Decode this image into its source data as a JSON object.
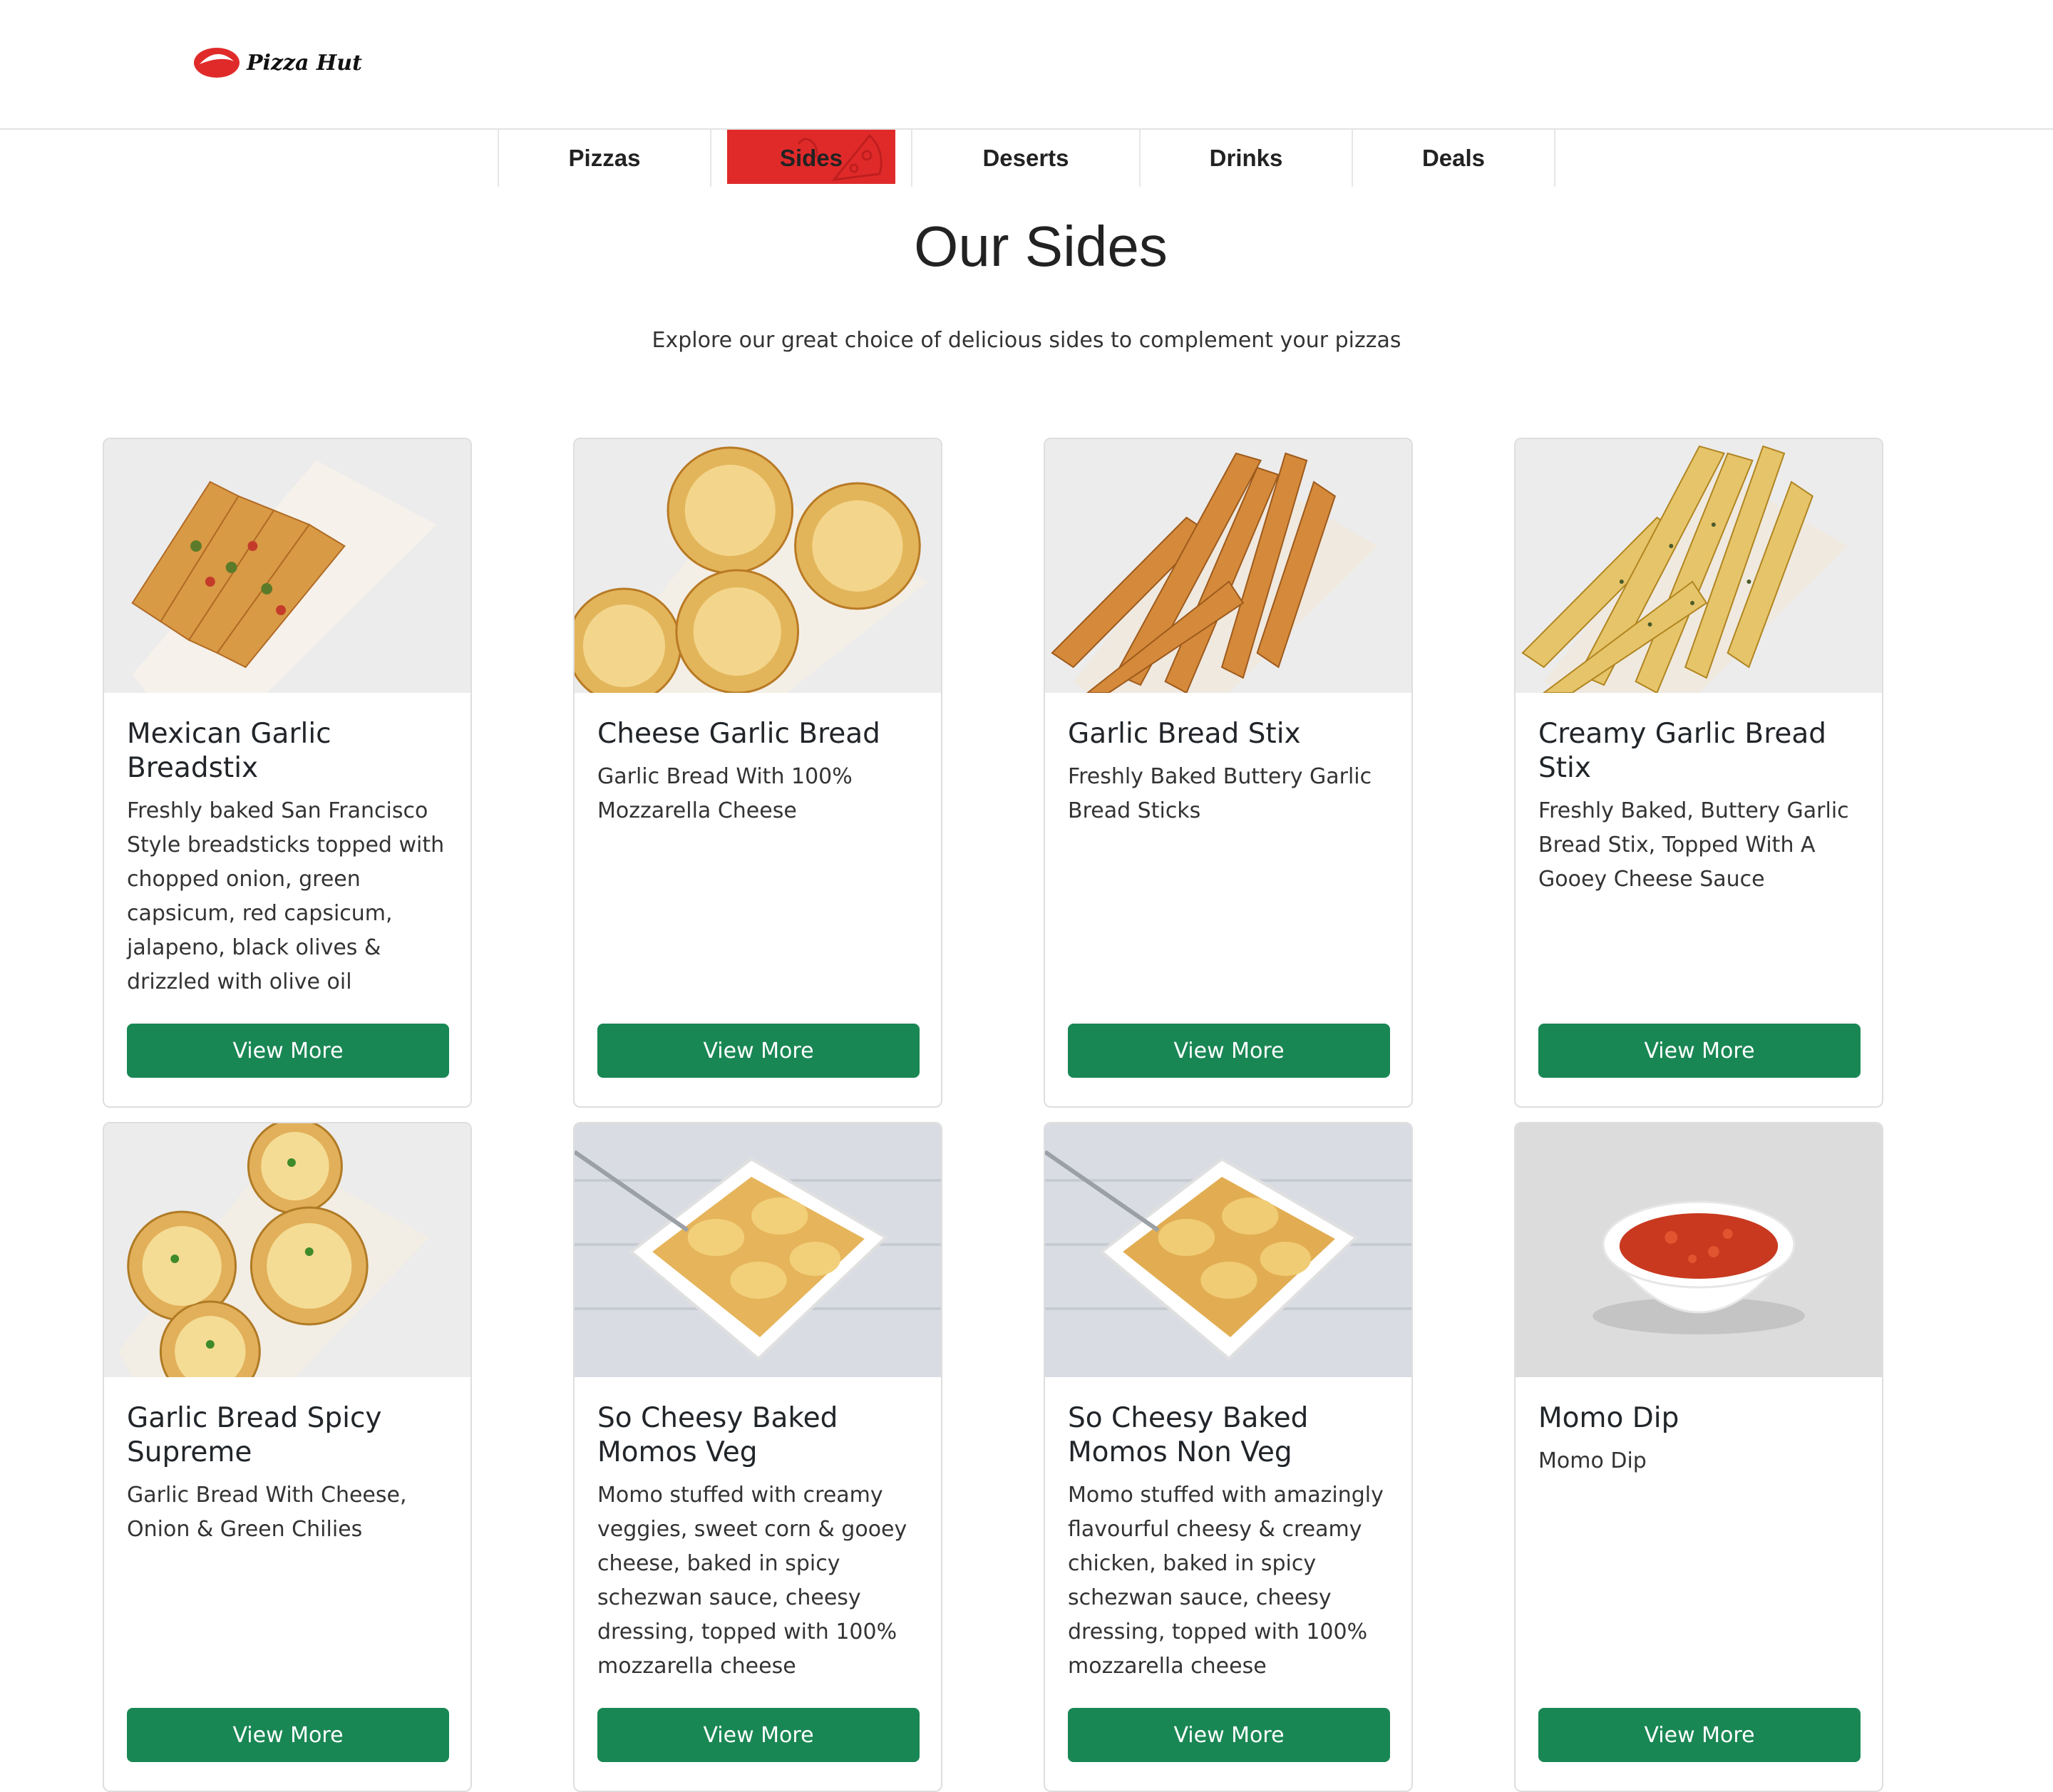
{
  "header": {
    "logo_text": "Pizza Hut",
    "brand_color": "#e02a2a"
  },
  "tabs": [
    {
      "label": "Pizzas",
      "active": false
    },
    {
      "label": "Sides",
      "active": true
    },
    {
      "label": "Deserts",
      "active": false
    },
    {
      "label": "Drinks",
      "active": false
    },
    {
      "label": "Deals",
      "active": false
    }
  ],
  "page": {
    "title": "Our Sides",
    "subtitle": "Explore our great choice of delicious sides to complement your pizzas"
  },
  "accent_button_color": "#198754",
  "products": [
    {
      "name": "Mexican Garlic Breadstix",
      "description": "Freshly baked San Francisco Style breadsticks topped with chopped onion, green capsicum, red capsicum, jalapeno, black olives & drizzled with olive oil",
      "button": "View More",
      "image": "mexican-breadstix-image"
    },
    {
      "name": "Cheese Garlic Bread",
      "description": "Garlic Bread With 100% Mozzarella Cheese",
      "button": "View More",
      "image": "cheese-garlic-bread-image"
    },
    {
      "name": "Garlic Bread Stix",
      "description": "Freshly Baked Buttery Garlic Bread Sticks",
      "button": "View More",
      "image": "garlic-bread-stix-image"
    },
    {
      "name": "Creamy Garlic Bread Stix",
      "description": "Freshly Baked, Buttery Garlic Bread Stix, Topped With A Gooey Cheese Sauce",
      "button": "View More",
      "image": "creamy-garlic-bread-stix-image"
    },
    {
      "name": "Garlic Bread Spicy Supreme",
      "description": "Garlic Bread With Cheese, Onion & Green Chilies",
      "button": "View More",
      "image": "garlic-bread-spicy-supreme-image"
    },
    {
      "name": "So Cheesy Baked Momos Veg",
      "description": "Momo stuffed with creamy veggies, sweet corn & gooey cheese, baked in spicy schezwan sauce, cheesy dressing, topped with 100% mozzarella cheese",
      "button": "View More",
      "image": "baked-momos-veg-image"
    },
    {
      "name": "So Cheesy Baked Momos Non Veg",
      "description": "Momo stuffed with amazingly flavourful cheesy & creamy chicken, baked in spicy schezwan sauce, cheesy dressing, topped with 100% mozzarella cheese",
      "button": "View More",
      "image": "baked-momos-nonveg-image"
    },
    {
      "name": "Momo Dip",
      "description": "Momo Dip",
      "button": "View More",
      "image": "momo-dip-image"
    }
  ]
}
